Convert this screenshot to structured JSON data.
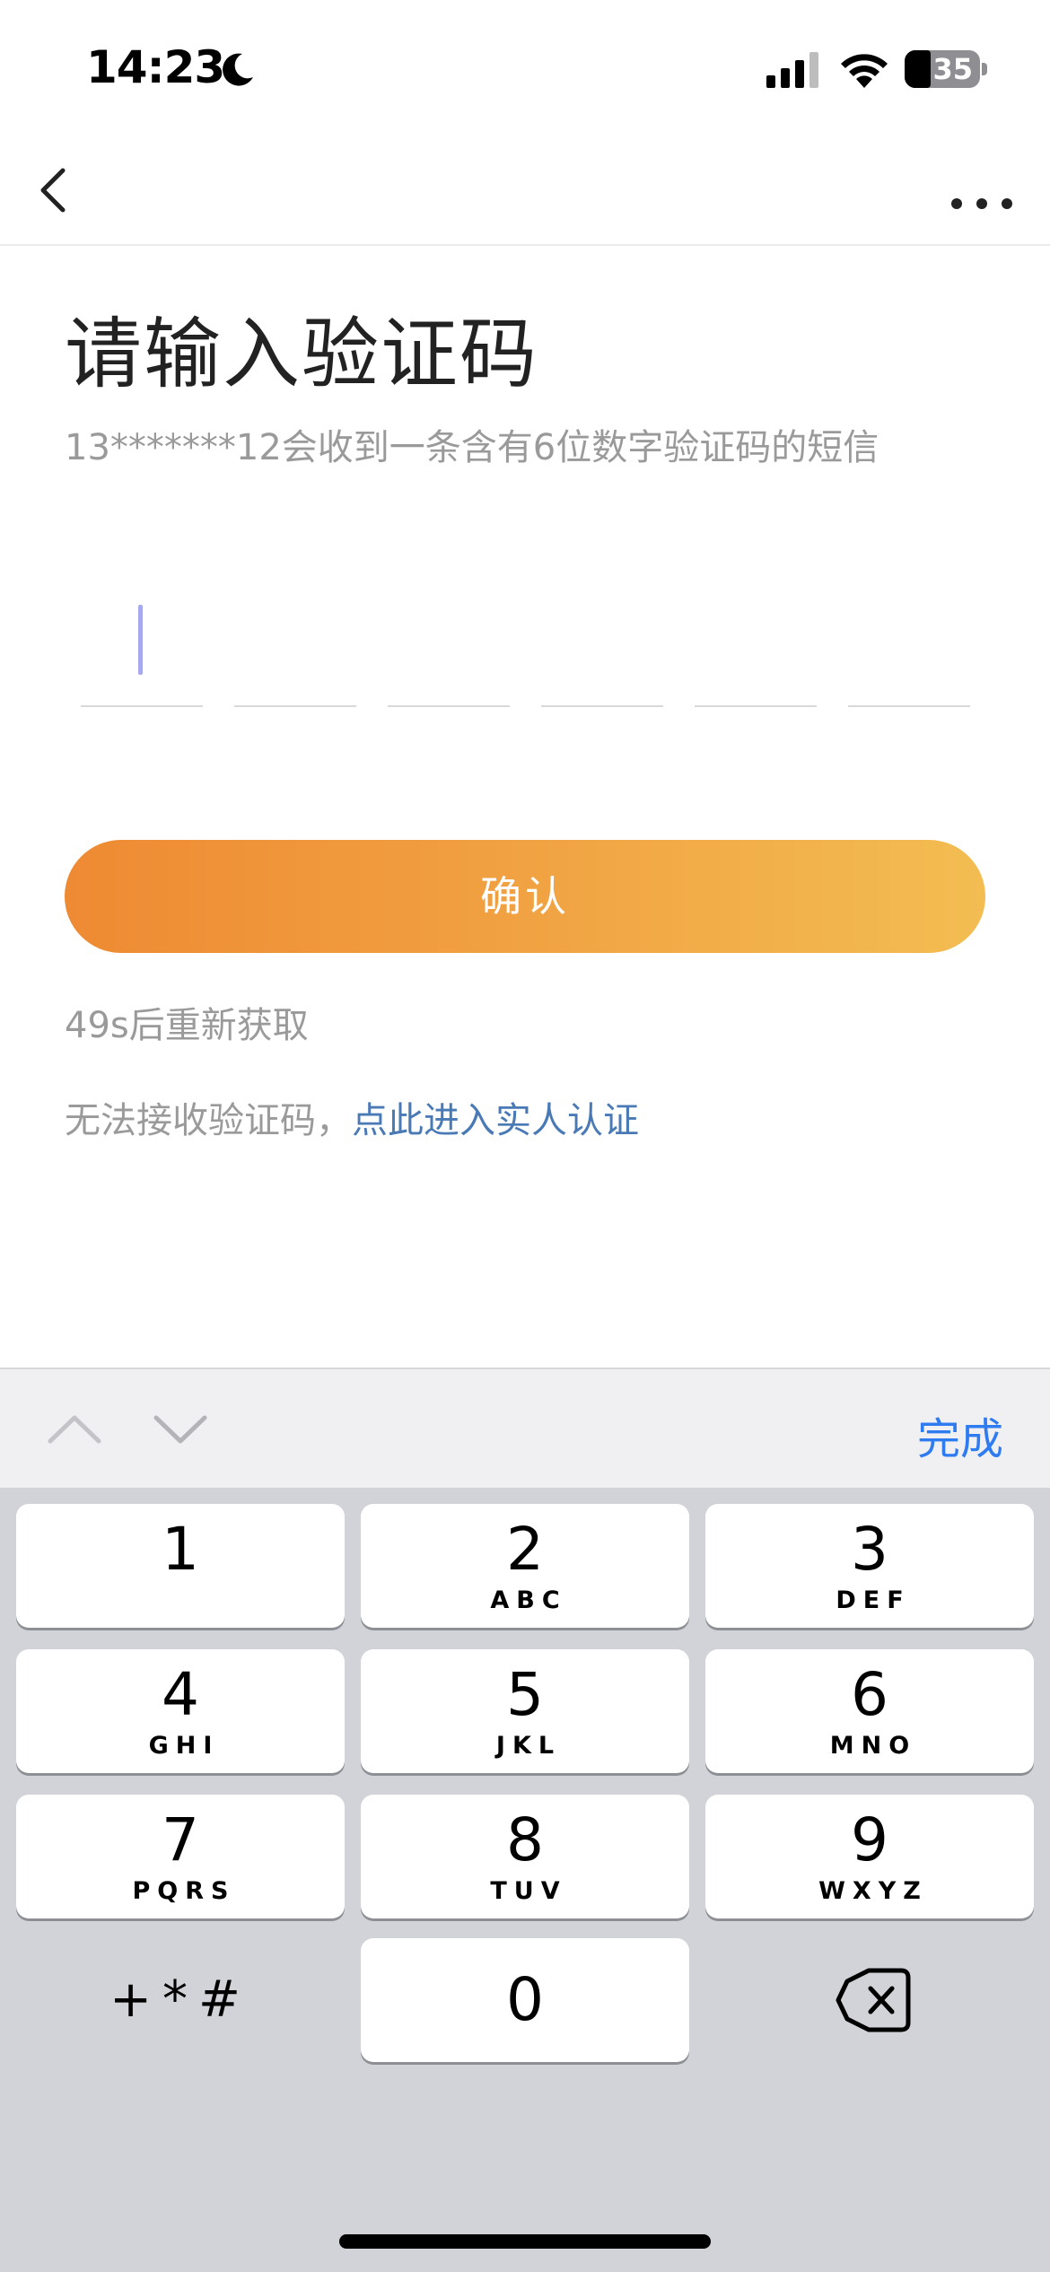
{
  "status_bar": {
    "time": "14:23",
    "battery": "35",
    "battery_level_percent": 35
  },
  "header": {
    "back_icon": "chevron-left-icon",
    "more_icon": "more-horizontal-icon"
  },
  "main": {
    "title": "请输入验证码",
    "subtitle": "13*******12会收到一条含有6位数字验证码的短信",
    "code_length": 6,
    "confirm_label": "确认",
    "resend_text": "49s后重新获取",
    "help_text": "无法接收验证码，",
    "help_link": "点此进入实人认证"
  },
  "keyboard": {
    "done_label": "完成",
    "keys": [
      {
        "digit": "1",
        "letters": ""
      },
      {
        "digit": "2",
        "letters": "ABC"
      },
      {
        "digit": "3",
        "letters": "DEF"
      },
      {
        "digit": "4",
        "letters": "GHI"
      },
      {
        "digit": "5",
        "letters": "JKL"
      },
      {
        "digit": "6",
        "letters": "MNO"
      },
      {
        "digit": "7",
        "letters": "PQRS"
      },
      {
        "digit": "8",
        "letters": "TUV"
      },
      {
        "digit": "9",
        "letters": "WXYZ"
      },
      {
        "digit": "0",
        "letters": ""
      }
    ],
    "symbols_label": "+*#"
  },
  "colors": {
    "accent_start": "#ee8a33",
    "accent_end": "#f3bd52",
    "link": "#4a7ab5",
    "done": "#2f7bf0"
  }
}
